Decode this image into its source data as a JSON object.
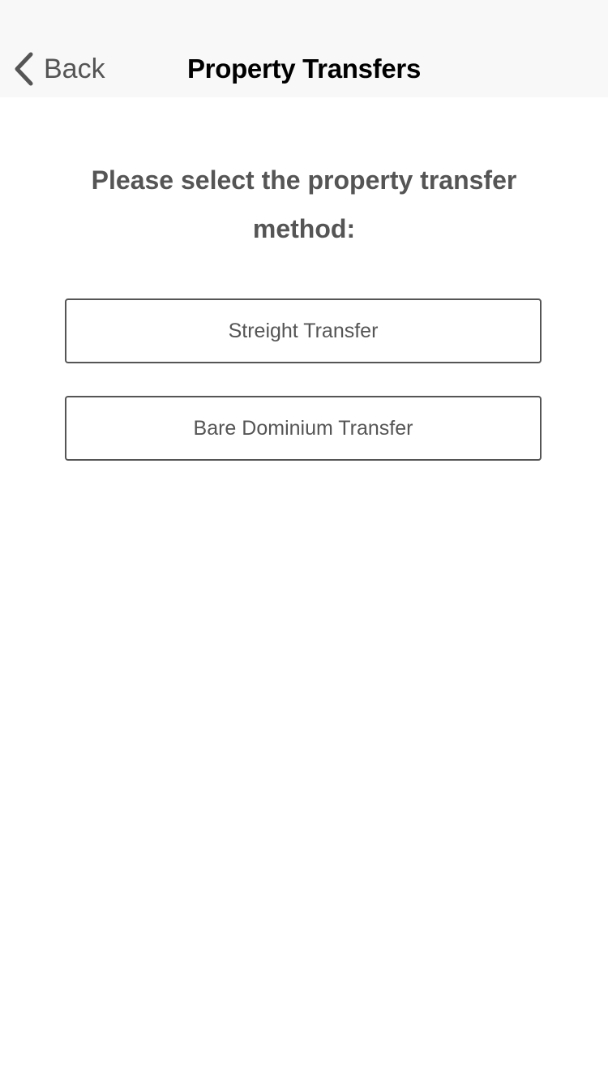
{
  "nav": {
    "back_icon": "chevron-left-icon",
    "back_label": "Back",
    "title": "Property Transfers"
  },
  "main": {
    "prompt": "Please select the property transfer method:",
    "options": [
      {
        "label": "Streight Transfer"
      },
      {
        "label": "Bare Dominium Transfer"
      }
    ]
  },
  "colors": {
    "nav_background": "#f8f8f8",
    "text_gray": "#555555",
    "title_black": "#000000",
    "button_border": "#555555"
  }
}
